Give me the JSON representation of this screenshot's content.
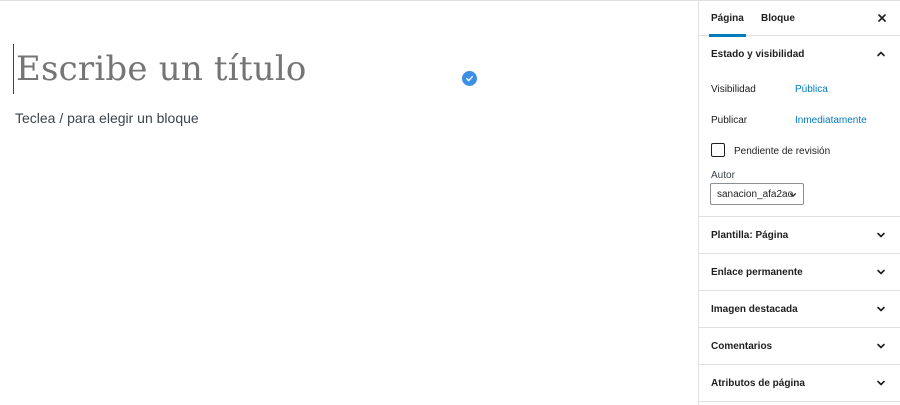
{
  "editor": {
    "title_placeholder": "Escribe un título",
    "block_prompt": "Teclea / para elegir un bloque"
  },
  "sidebar": {
    "tabs": [
      {
        "label": "Página",
        "active": true
      },
      {
        "label": "Bloque",
        "active": false
      }
    ],
    "panels": {
      "status": {
        "title": "Estado y visibilidad",
        "expanded": true,
        "visibility_label": "Visibilidad",
        "visibility_value": "Pública",
        "publish_label": "Publicar",
        "publish_value": "Inmediatamente",
        "pending_review_label": "Pendiente de revisión",
        "pending_review_checked": false,
        "author_label": "Autor",
        "author_value": "sanacion_afa2ao"
      },
      "collapsed": [
        {
          "title": "Plantilla: Página"
        },
        {
          "title": "Enlace permanente"
        },
        {
          "title": "Imagen destacada"
        },
        {
          "title": "Comentarios"
        },
        {
          "title": "Atributos de página"
        }
      ]
    }
  },
  "colors": {
    "accent": "#007cba",
    "check_badge": "#3c8fe6",
    "border": "#e0e0e0"
  },
  "icons": {
    "close": "close-icon",
    "chevron_up": "chevron-up-icon",
    "chevron_down": "chevron-down-icon",
    "check": "check-icon"
  }
}
